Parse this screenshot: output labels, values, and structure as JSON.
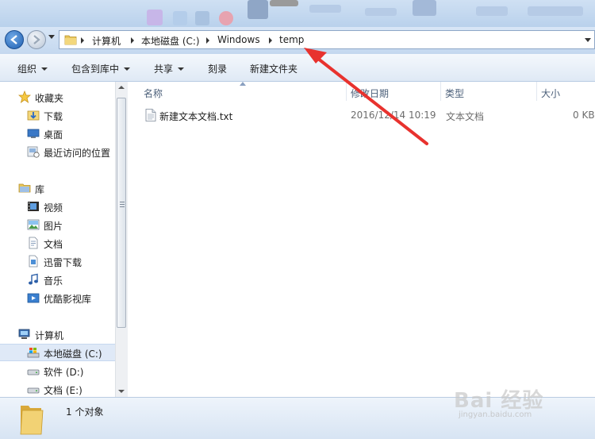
{
  "address_bar": {
    "crumbs": [
      "计算机",
      "本地磁盘 (C:)",
      "Windows",
      "temp"
    ]
  },
  "toolbar": {
    "organize": "组织",
    "include_in_library": "包含到库中",
    "share": "共享",
    "burn": "刻录",
    "new_folder": "新建文件夹"
  },
  "nav": {
    "favorites": "收藏夹",
    "downloads": "下载",
    "desktop": "桌面",
    "recent": "最近访问的位置",
    "libraries": "库",
    "videos": "视频",
    "pictures": "图片",
    "documents": "文档",
    "xunlei": "迅雷下载",
    "music": "音乐",
    "youku": "优酷影视库",
    "computer": "计算机",
    "drive_c": "本地磁盘 (C:)",
    "drive_d": "软件 (D:)",
    "drive_e": "文档 (E:)"
  },
  "columns": {
    "name": "名称",
    "date": "修改日期",
    "type": "类型",
    "size": "大小"
  },
  "files": [
    {
      "name": "新建文本文档.txt",
      "date": "2016/12/14 10:19",
      "type": "文本文档",
      "size": "0 KB"
    }
  ],
  "status": {
    "count": "1 个对象"
  },
  "watermark": {
    "main": "Bai 经验",
    "sub": "jingyan.baidu.com"
  },
  "colors": {
    "annotation_arrow": "#e8322e",
    "selection": "#dfe9f7"
  }
}
